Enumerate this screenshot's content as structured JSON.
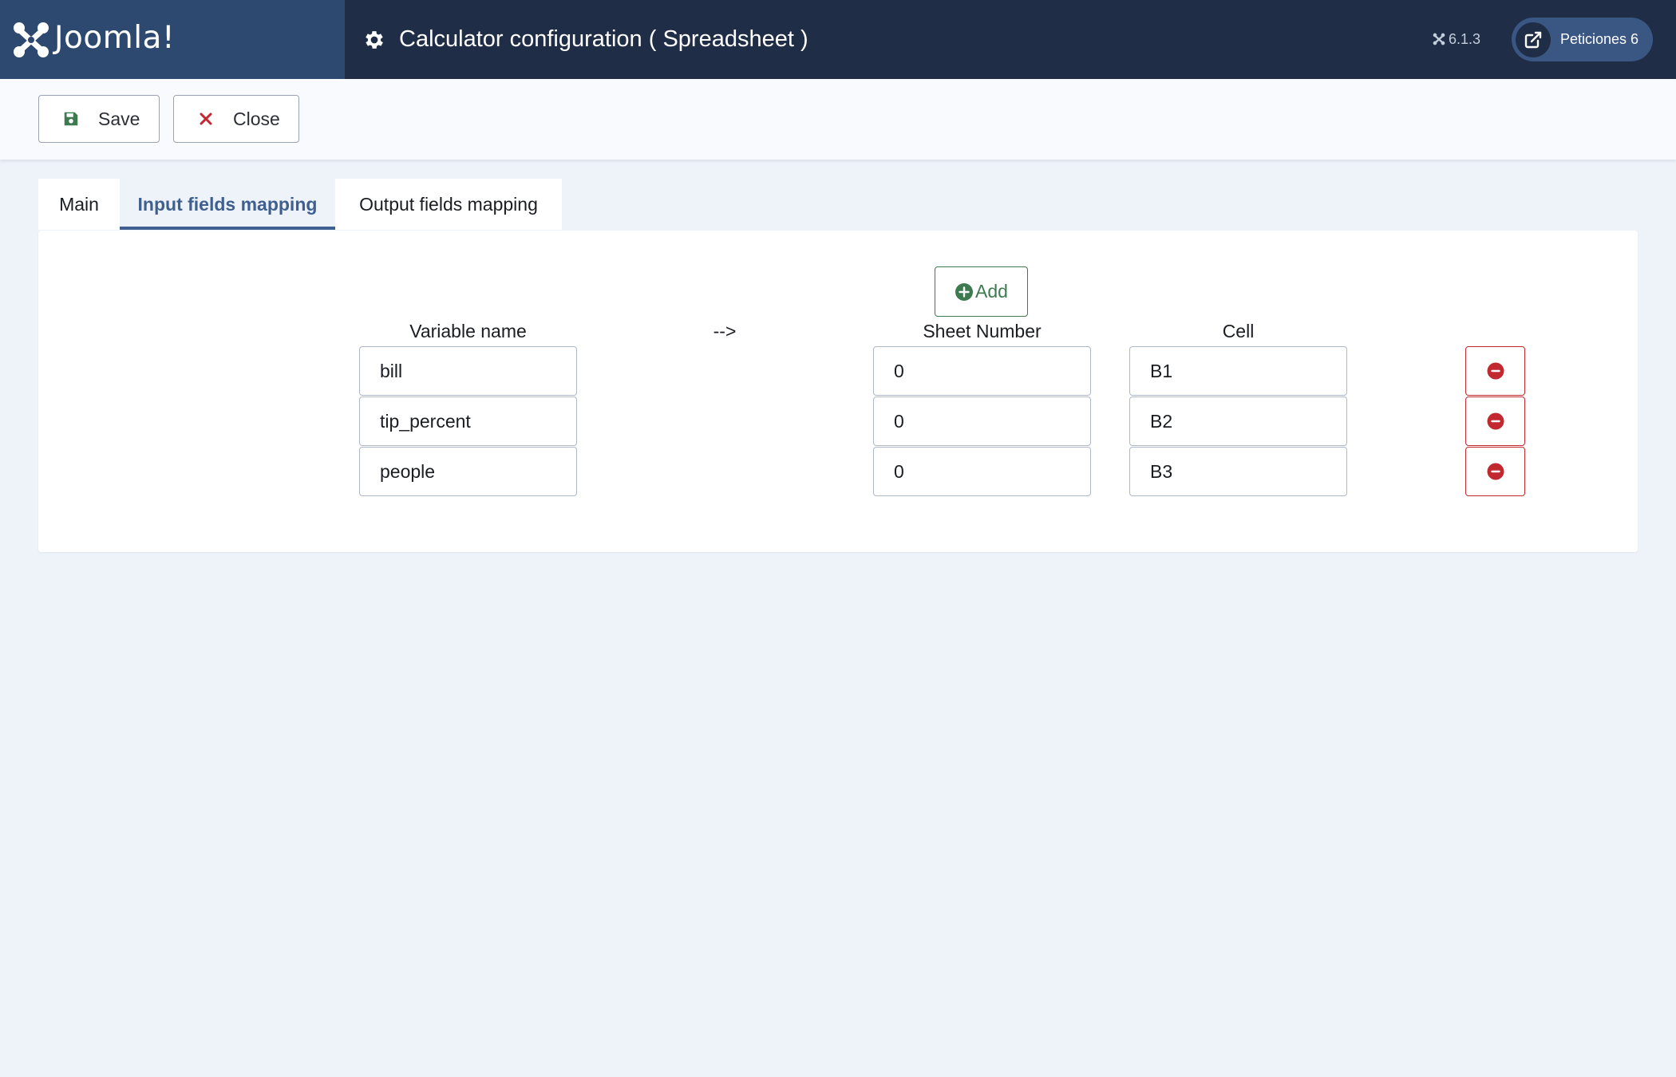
{
  "header": {
    "logo_text": "Joomla!",
    "title": "Calculator configuration ( Spreadsheet )",
    "version": "6.1.3",
    "requests_label": "Peticiones 6"
  },
  "toolbar": {
    "save_label": "Save",
    "close_label": "Close"
  },
  "tabs": [
    {
      "label": "Main",
      "active": false
    },
    {
      "label": "Input fields mapping",
      "active": true
    },
    {
      "label": "Output fields mapping",
      "active": false
    }
  ],
  "mapping": {
    "add_label": "Add",
    "headers": {
      "variable": "Variable name",
      "arrow": "-->",
      "sheet": "Sheet Number",
      "cell": "Cell"
    },
    "rows": [
      {
        "variable": "bill",
        "sheet": "0",
        "cell": "B1"
      },
      {
        "variable": "tip_percent",
        "sheet": "0",
        "cell": "B2"
      },
      {
        "variable": "people",
        "sheet": "0",
        "cell": "B3"
      }
    ]
  },
  "colors": {
    "header_bg": "#1f2d46",
    "logo_bg": "#2e4970",
    "accent": "#3e5f8f",
    "success": "#3e7a4f",
    "danger": "#c2282f",
    "page_bg": "#eef3fa"
  }
}
